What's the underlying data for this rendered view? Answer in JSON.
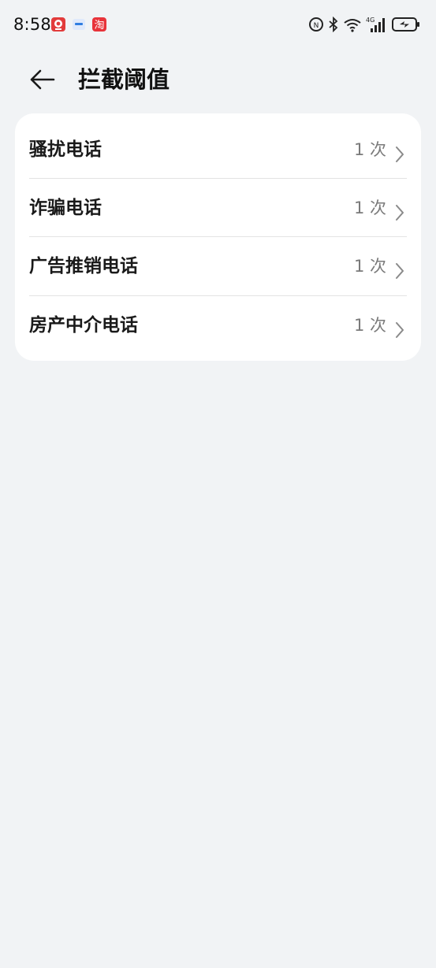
{
  "status_bar": {
    "time": "8:58",
    "notifications": [
      {
        "icon": "app-notification-icon-1",
        "color": "#e23b3b"
      },
      {
        "icon": "app-notification-icon-2",
        "color": "#2f7de1"
      },
      {
        "icon": "taobao-icon",
        "label": "淘",
        "color": "#e8333a"
      }
    ],
    "signal_label": "4G",
    "battery_state": "charging"
  },
  "header": {
    "title": "拦截阈值"
  },
  "list": {
    "items": [
      {
        "label": "骚扰电话",
        "value": "1 次"
      },
      {
        "label": "诈骗电话",
        "value": "1 次"
      },
      {
        "label": "广告推销电话",
        "value": "1 次"
      },
      {
        "label": "房产中介电话",
        "value": "1 次"
      }
    ]
  }
}
